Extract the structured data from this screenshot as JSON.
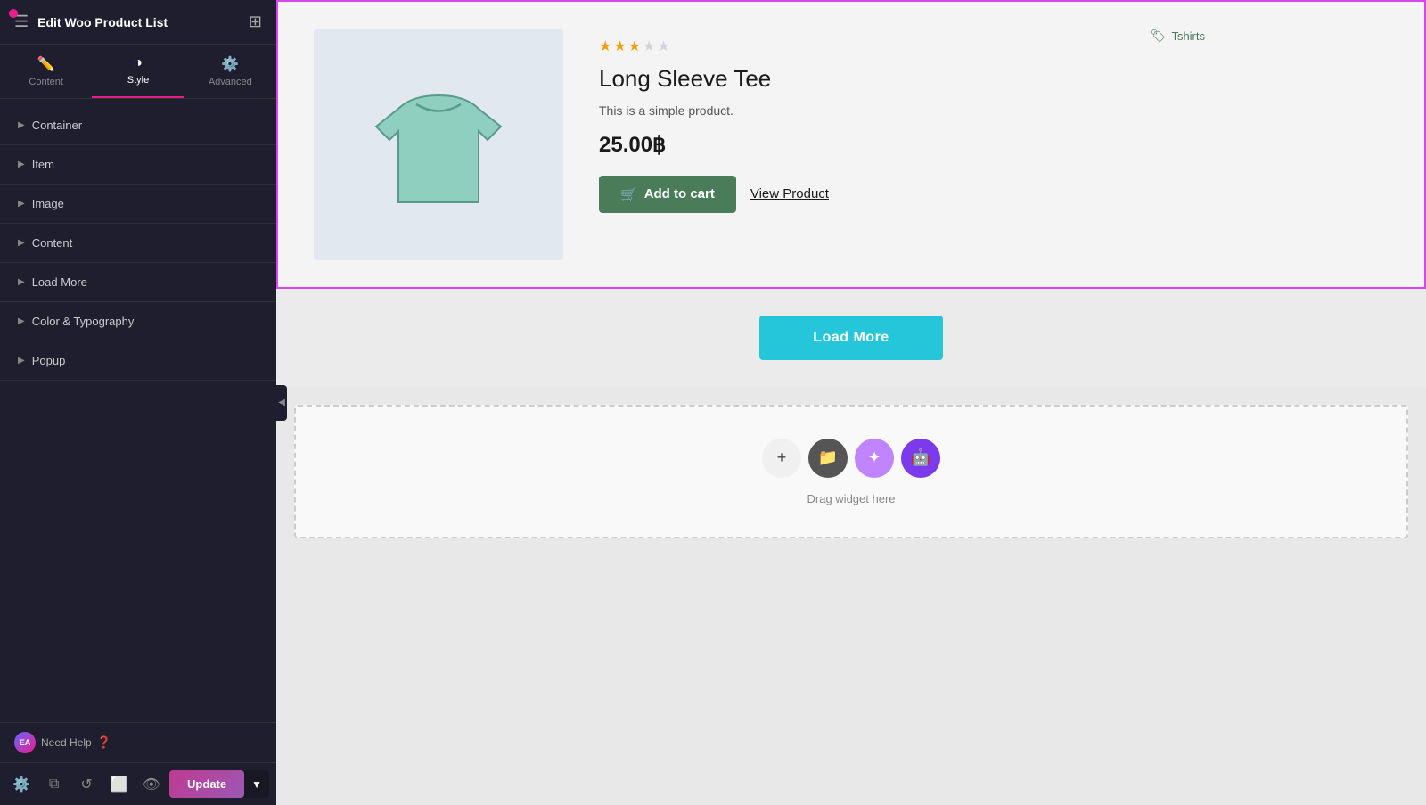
{
  "sidebar": {
    "title": "Edit Woo Product List",
    "tabs": [
      {
        "id": "content",
        "label": "Content",
        "icon": "✏️"
      },
      {
        "id": "style",
        "label": "Style",
        "icon": "◑",
        "active": true
      },
      {
        "id": "advanced",
        "label": "Advanced",
        "icon": "⚙️"
      }
    ],
    "sections": [
      {
        "id": "container",
        "label": "Container"
      },
      {
        "id": "item",
        "label": "Item"
      },
      {
        "id": "image",
        "label": "Image"
      },
      {
        "id": "content",
        "label": "Content"
      },
      {
        "id": "load-more",
        "label": "Load More"
      },
      {
        "id": "color-typography",
        "label": "Color & Typography"
      },
      {
        "id": "popup",
        "label": "Popup"
      }
    ],
    "footer": {
      "badge_text": "EA",
      "help_text": "Need Help"
    },
    "toolbar": {
      "update_label": "Update"
    }
  },
  "product": {
    "category": "Tshirts",
    "stars_filled": 3,
    "stars_total": 5,
    "name": "Long Sleeve Tee",
    "description": "This is a simple product.",
    "price": "25.00฿",
    "add_to_cart_label": "Add to cart",
    "view_product_label": "View Product"
  },
  "load_more": {
    "label": "Load More"
  },
  "widget_drop": {
    "drag_text": "Drag widget here"
  }
}
